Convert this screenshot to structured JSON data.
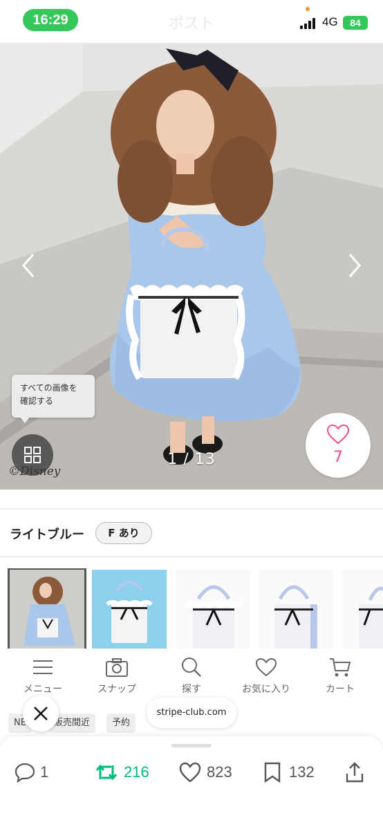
{
  "status_bar": {
    "time": "16:29",
    "ghost_title": "ポスト",
    "network": "4G",
    "battery": "84"
  },
  "hero": {
    "tooltip_line1": "すべての画像を",
    "tooltip_line2": "確認する",
    "watermark": "©Disney",
    "counter": "1 / 13",
    "like_count": "7"
  },
  "product": {
    "color_name": "ライトブルー",
    "size_badge": "F あり"
  },
  "shop_nav": {
    "items": [
      {
        "label": "メニュー",
        "icon": "menu-icon"
      },
      {
        "label": "スナップ",
        "icon": "camera-icon"
      },
      {
        "label": "探す",
        "icon": "search-icon"
      },
      {
        "label": "お気に入り",
        "icon": "heart-icon"
      },
      {
        "label": "カート",
        "icon": "cart-icon"
      }
    ]
  },
  "tags": [
    "NE",
    "販売間近",
    "予約"
  ],
  "url_pill": "stripe-club.com",
  "actions": {
    "replies": "1",
    "reposts": "216",
    "likes": "823",
    "bookmarks": "132"
  },
  "colors": {
    "accent_green": "#34c759",
    "repost_green": "#00ba7c",
    "like_pink": "#e94e8a"
  }
}
